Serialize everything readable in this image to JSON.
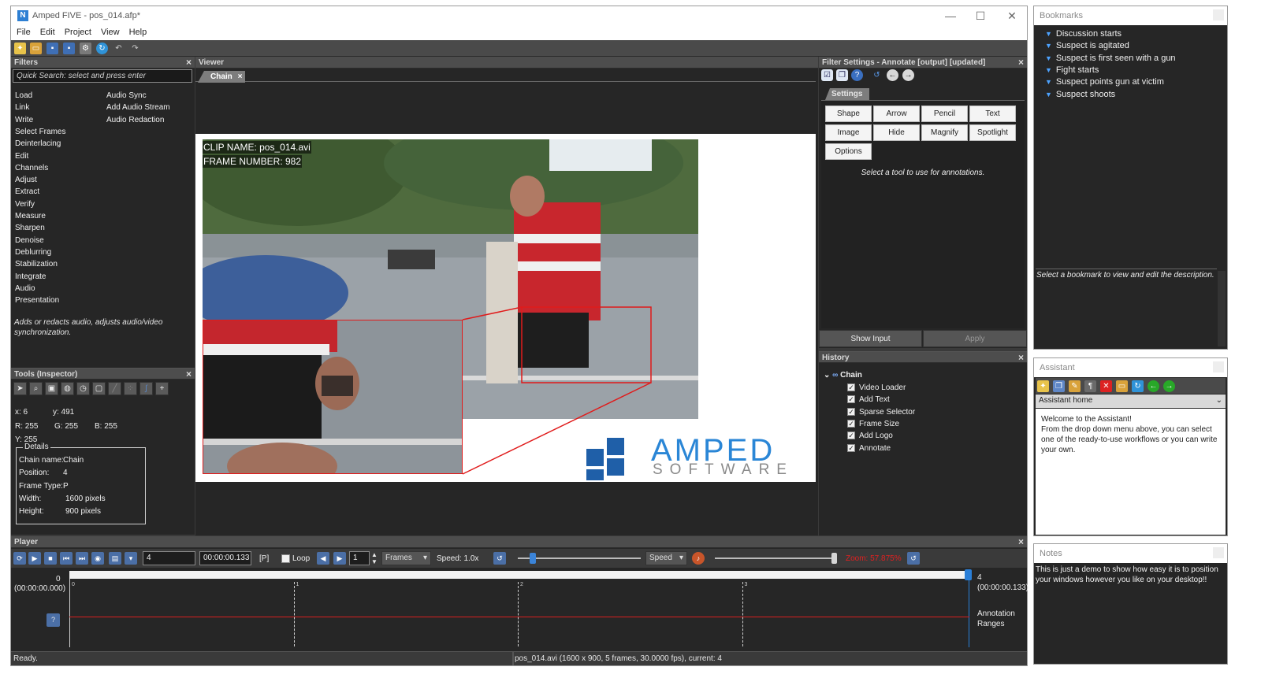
{
  "window": {
    "title": "Amped FIVE  - pos_014.afp*",
    "app_icon": "N",
    "min": "—",
    "max": "☐",
    "close": "✕"
  },
  "menu": [
    "File",
    "Edit",
    "Project",
    "View",
    "Help"
  ],
  "filters": {
    "header": "Filters",
    "search_placeholder": "Quick Search: select and press enter",
    "col1": [
      "Load",
      "Link",
      "Write",
      "Select Frames",
      "Deinterlacing",
      "Edit",
      "Channels",
      "Adjust",
      "Extract",
      "Verify",
      "Measure",
      "Sharpen",
      "Denoise",
      "Deblurring",
      "Stabilization",
      "Integrate",
      "Audio",
      "Presentation"
    ],
    "col2": [
      "Audio Sync",
      "Add Audio Stream",
      "Audio Redaction"
    ],
    "description": "Adds or redacts audio, adjusts audio/video synchronization."
  },
  "tools": {
    "header": "Tools (Inspector)",
    "x": "x: 6",
    "y": "y: 491",
    "r": "R: 255",
    "g": "G: 255",
    "b": "B: 255",
    "yy": "Y: 255",
    "details_legend": "Details",
    "details": [
      {
        "k": "Chain name:",
        "v": "Chain"
      },
      {
        "k": "Position:",
        "v": "4"
      },
      {
        "k": "Frame Type:",
        "v": "P"
      },
      {
        "k": "Width:",
        "v": "1600 pixels"
      },
      {
        "k": "Height:",
        "v": "900 pixels"
      }
    ]
  },
  "viewer": {
    "header": "Viewer",
    "tab": "Chain",
    "clip_name": "CLIP NAME: pos_014.avi",
    "frame_number": "FRAME NUMBER: 982",
    "logo_main": "AMPED",
    "logo_sub": "SOFTWARE"
  },
  "settings": {
    "header": "Filter Settings - Annotate [output] [updated]",
    "tab": "Settings",
    "buttons": [
      "Shape",
      "Arrow",
      "Pencil",
      "Text",
      "Image",
      "Hide",
      "Magnify",
      "Spotlight",
      "Options"
    ],
    "hint": "Select a tool to use for annotations.",
    "show_input": "Show Input",
    "apply": "Apply"
  },
  "history": {
    "header": "History",
    "root": "Chain",
    "items": [
      "Video Loader",
      "Add Text",
      "Sparse Selector",
      "Frame Size",
      "Add Logo",
      "Annotate"
    ]
  },
  "player": {
    "header": "Player",
    "frame": "4",
    "time": "00:00:00.133",
    "ptype": "[P]",
    "loop": "Loop",
    "step": "1",
    "unit": "Frames",
    "speed_label": "Speed: 1.0x",
    "speed_dd": "Speed",
    "zoom": "Zoom: 57.875%",
    "start_frame": "0",
    "start_time": "(00:00:00.000)",
    "end_frame": "4",
    "end_time": "(00:00:00.133)",
    "ticks": [
      "0",
      "1",
      "2",
      "3"
    ],
    "track_label_1": "Annotation",
    "track_label_2": "Ranges",
    "speed_level": 0.12,
    "zoom_level": 0.98
  },
  "status": {
    "left": "Ready.",
    "info": "pos_014.avi (1600 x 900, 5 frames, 30.0000 fps), current: 4"
  },
  "bookmarks": {
    "title": "Bookmarks",
    "items": [
      "Discussion starts",
      "Suspect is agitated",
      "Suspect is first seen with a gun",
      "Fight starts",
      "Suspect points gun at victim",
      "Suspect shoots"
    ],
    "hint": "Select a bookmark to view and edit the description."
  },
  "assistant": {
    "title": "Assistant",
    "dropdown": "Assistant home",
    "text": "Welcome to the Assistant!\nFrom the drop down menu above, you can select one of the ready-to-use workflows or you can write your own."
  },
  "notes": {
    "title": "Notes",
    "text": "This is just a demo to show how easy it is to position your windows however you like on your desktop!!"
  }
}
